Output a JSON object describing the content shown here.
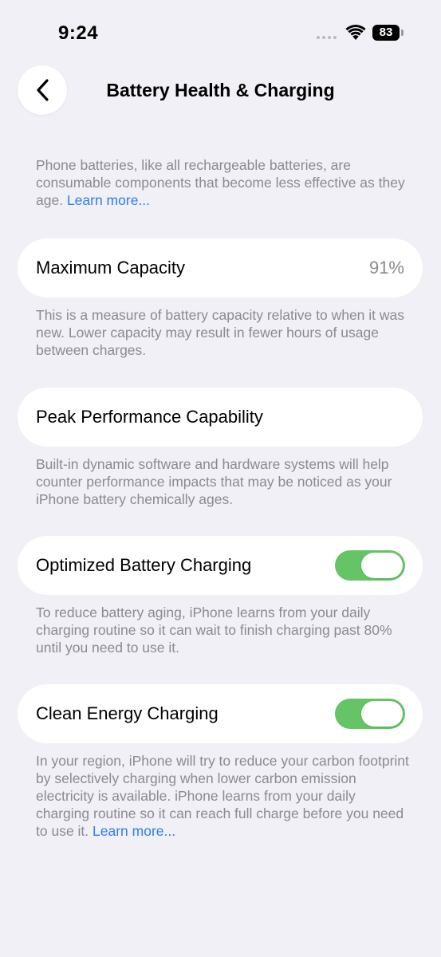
{
  "status_bar": {
    "time": "9:24",
    "battery_level": "83"
  },
  "header": {
    "title": "Battery Health & Charging"
  },
  "intro": {
    "text": "Phone batteries, like all rechargeable batteries, are consumable components that become less effective as they age. ",
    "link": "Learn more..."
  },
  "maximum_capacity": {
    "label": "Maximum Capacity",
    "value": "91%",
    "footnote": "This is a measure of battery capacity relative to when it was new. Lower capacity may result in fewer hours of usage between charges."
  },
  "peak_performance": {
    "label": "Peak Performance Capability",
    "footnote": "Built-in dynamic software and hardware systems will help counter performance impacts that may be noticed as your iPhone battery chemically ages."
  },
  "optimized_charging": {
    "label": "Optimized Battery Charging",
    "enabled": true,
    "footnote": "To reduce battery aging, iPhone learns from your daily charging routine so it can wait to finish charging past 80% until you need to use it."
  },
  "clean_energy": {
    "label": "Clean Energy Charging",
    "enabled": true,
    "footnote": "In your region, iPhone will try to reduce your carbon footprint by selectively charging when lower carbon emission electricity is available. iPhone learns from your daily charging routine so it can reach full charge before you need to use it. ",
    "link": "Learn more..."
  },
  "colors": {
    "background": "#f0f0f6",
    "link": "#2e7cf6",
    "toggle_on": "#65c466",
    "secondary_text": "#8a8a8f"
  }
}
